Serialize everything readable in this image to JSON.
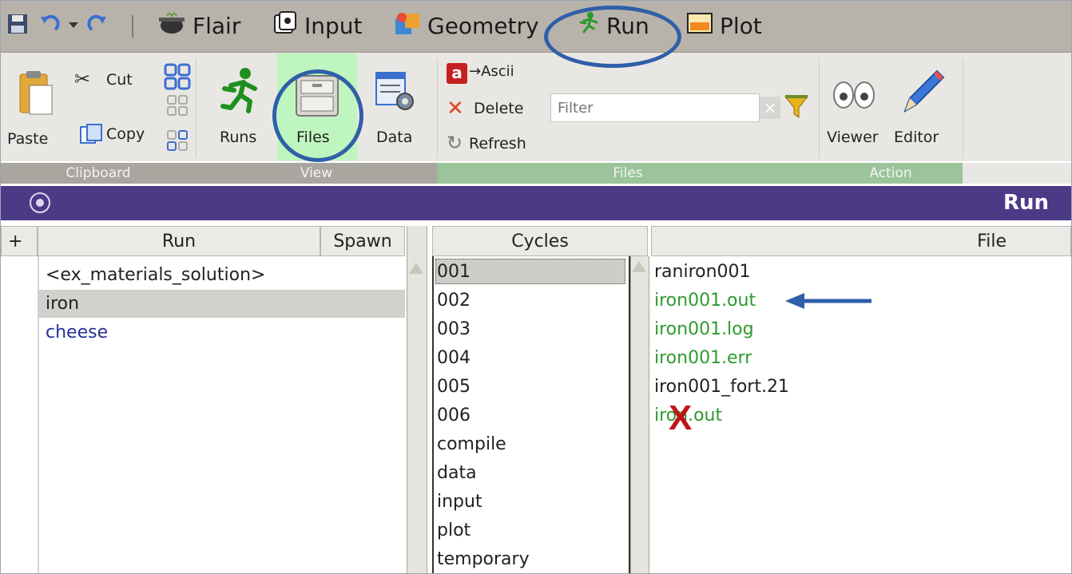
{
  "tabs": {
    "flair": "Flair",
    "input": "Input",
    "geometry": "Geometry",
    "run": "Run",
    "plot": "Plot"
  },
  "ribbon": {
    "clipboard": {
      "paste": "Paste",
      "cut": "Cut",
      "copy": "Copy",
      "group": "Clipboard"
    },
    "view": {
      "runs": "Runs",
      "files": "Files",
      "data": "Data",
      "group": "View"
    },
    "files": {
      "ascii": "→Ascii",
      "delete": "Delete",
      "refresh": "Refresh",
      "filter_placeholder": "Filter",
      "group": "Files"
    },
    "action": {
      "viewer": "Viewer",
      "editor": "Editor",
      "group": "Action"
    }
  },
  "header": {
    "title": "Run"
  },
  "runs_table": {
    "add": "+",
    "col_run": "Run",
    "col_spawn": "Spawn",
    "rows": [
      "<ex_materials_solution>",
      "iron",
      "cheese"
    ]
  },
  "cycles": {
    "header": "Cycles",
    "items": [
      "001",
      "002",
      "003",
      "004",
      "005",
      "006",
      "compile",
      "data",
      "input",
      "plot",
      "temporary"
    ]
  },
  "files_list": {
    "header": "File",
    "items": [
      "raniron001",
      "iron001.out",
      "iron001.log",
      "iron001.err",
      "iron001_fort.21",
      "iron.out"
    ]
  },
  "annotations": {
    "cross_mark": "X"
  },
  "colors": {
    "accent": "#4d3a87",
    "annotation": "#2f5fa8",
    "green_file": "#2f9a30",
    "cross": "#c0141b"
  }
}
